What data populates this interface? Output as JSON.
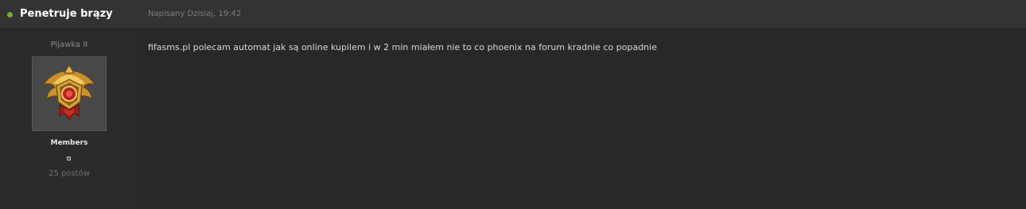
{
  "post": {
    "author": "Penetruje brązy",
    "author_status": "online",
    "date": "Napisany Dzisiaj, 19:42",
    "rank_title": "Pijawka II",
    "avatar_icon": "gold-rank-emblem-icon",
    "group": "Members",
    "post_count": "25 postów",
    "body": "fifasms.pl polecam automat jak są online kupilem i w 2 min miałem nie to co phoenix na forum kradnie co popadnie"
  },
  "colors": {
    "online": "#6fa83a",
    "header_bg": "#333333",
    "page_bg": "#282828"
  }
}
